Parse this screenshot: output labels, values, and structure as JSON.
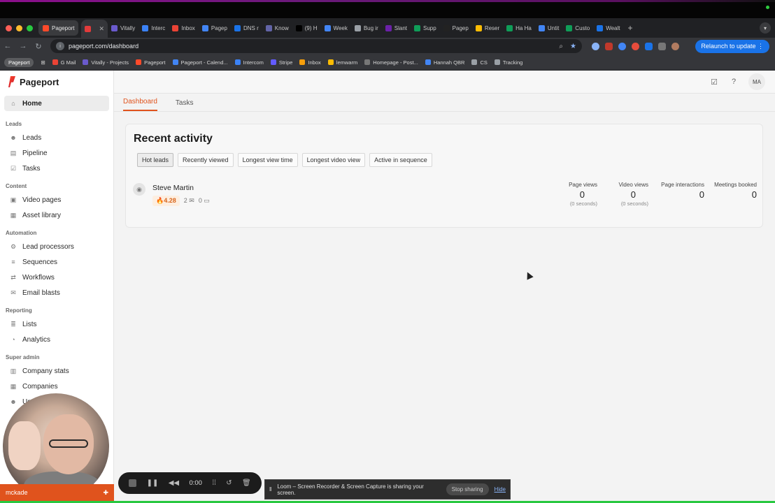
{
  "browser": {
    "tabs": [
      {
        "label": "Pageport",
        "color": "#ff4a2a",
        "pinned": true
      },
      {
        "label": "",
        "color": "#e23b3b",
        "active": true
      },
      {
        "label": "Vitally",
        "color": "#6a5acd"
      },
      {
        "label": "Interc",
        "color": "#3b82f6"
      },
      {
        "label": "Inbox",
        "color": "#ea4335"
      },
      {
        "label": "Pagep",
        "color": "#4285f4"
      },
      {
        "label": "DNS r",
        "color": "#1a73e8"
      },
      {
        "label": "Know",
        "color": "#6264a7"
      },
      {
        "label": "(9) H",
        "color": "#000000"
      },
      {
        "label": "Week",
        "color": "#4285f4"
      },
      {
        "label": "Bug ir",
        "color": "#9aa0a6"
      },
      {
        "label": "Slant",
        "color": "#6b21a8"
      },
      {
        "label": "Supp",
        "color": "#0f9d58"
      },
      {
        "label": "Pagep",
        "color": "#222222"
      },
      {
        "label": "Reser",
        "color": "#fbbc04"
      },
      {
        "label": "Ha Ha",
        "color": "#0f9d58"
      },
      {
        "label": "Untit",
        "color": "#4285f4"
      },
      {
        "label": "Custo",
        "color": "#0f9d58"
      },
      {
        "label": "Wealt",
        "color": "#1a73e8"
      }
    ],
    "new_tab": "+",
    "url": "pageport.com/dashboard",
    "relaunch": "Relaunch to update",
    "bookmarks": [
      {
        "label": "Pageport",
        "profile": true,
        "color": "#777777"
      },
      {
        "label": "G Mail",
        "color": "#ea4335"
      },
      {
        "label": "Vitally - Projects",
        "color": "#6a5acd"
      },
      {
        "label": "Pageport",
        "color": "#ff4a2a"
      },
      {
        "label": "Pageport - Calend...",
        "color": "#4285f4"
      },
      {
        "label": "Intercom",
        "color": "#3b82f6"
      },
      {
        "label": "Stripe",
        "color": "#635bff"
      },
      {
        "label": "Inbox",
        "color": "#f59e0b"
      },
      {
        "label": "lemwarm",
        "color": "#fbbc04"
      },
      {
        "label": "Homepage - Post...",
        "color": "#777777"
      },
      {
        "label": "Hannah QBR",
        "color": "#4285f4"
      },
      {
        "label": "CS",
        "color": "#9aa0a6"
      },
      {
        "label": "Tracking",
        "color": "#9aa0a6"
      }
    ]
  },
  "app": {
    "brand": "Pageport",
    "accent": "#e0531d",
    "sidebar": {
      "home": "Home",
      "sections": [
        {
          "title": "Leads",
          "items": [
            {
              "label": "Leads",
              "icon": "people-icon",
              "glyph": "☻"
            },
            {
              "label": "Pipeline",
              "icon": "pipeline-icon",
              "glyph": "▤"
            },
            {
              "label": "Tasks",
              "icon": "checkbox-icon",
              "glyph": "☑"
            }
          ]
        },
        {
          "title": "Content",
          "items": [
            {
              "label": "Video pages",
              "icon": "video-icon",
              "glyph": "▣"
            },
            {
              "label": "Asset library",
              "icon": "library-icon",
              "glyph": "▦"
            }
          ]
        },
        {
          "title": "Automation",
          "items": [
            {
              "label": "Lead processors",
              "icon": "processor-icon",
              "glyph": "⚙"
            },
            {
              "label": "Sequences",
              "icon": "list-icon",
              "glyph": "≡"
            },
            {
              "label": "Workflows",
              "icon": "workflow-icon",
              "glyph": "⇄"
            },
            {
              "label": "Email blasts",
              "icon": "megaphone-icon",
              "glyph": "✉"
            }
          ]
        },
        {
          "title": "Reporting",
          "items": [
            {
              "label": "Lists",
              "icon": "list-icon",
              "glyph": "≣"
            },
            {
              "label": "Analytics",
              "icon": "chart-icon",
              "glyph": "◔"
            }
          ]
        },
        {
          "title": "Super admin",
          "items": [
            {
              "label": "Company stats",
              "icon": "stats-icon",
              "glyph": "▥"
            },
            {
              "label": "Companies",
              "icon": "building-icon",
              "glyph": "▦"
            },
            {
              "label": "Users",
              "icon": "people-icon",
              "glyph": "☻"
            }
          ]
        }
      ]
    },
    "topbar": {
      "avatar": "MA"
    },
    "tabs": [
      {
        "label": "Dashboard",
        "active": true
      },
      {
        "label": "Tasks",
        "active": false
      }
    ],
    "recent": {
      "title": "Recent activity",
      "filters": [
        "Hot leads",
        "Recently viewed",
        "Longest view time",
        "Longest video view",
        "Active in sequence"
      ],
      "active_filter": "Hot leads",
      "lead": {
        "name": "Steve Martin",
        "score": "4.28",
        "emails": "2",
        "messages": "0",
        "stats": [
          {
            "label": "Page views",
            "value": "0",
            "sub": "(0 seconds)"
          },
          {
            "label": "Video views",
            "value": "0",
            "sub": "(0 seconds)"
          },
          {
            "label": "Page interactions",
            "value": "0",
            "sub": ""
          },
          {
            "label": "Meetings booked",
            "value": "0",
            "sub": ""
          }
        ]
      }
    }
  },
  "loom": {
    "time": "0:00",
    "user": "mckade",
    "share_text": "Loom – Screen Recorder & Screen Capture is sharing your screen.",
    "stop_sharing": "Stop sharing",
    "hide": "Hide"
  }
}
